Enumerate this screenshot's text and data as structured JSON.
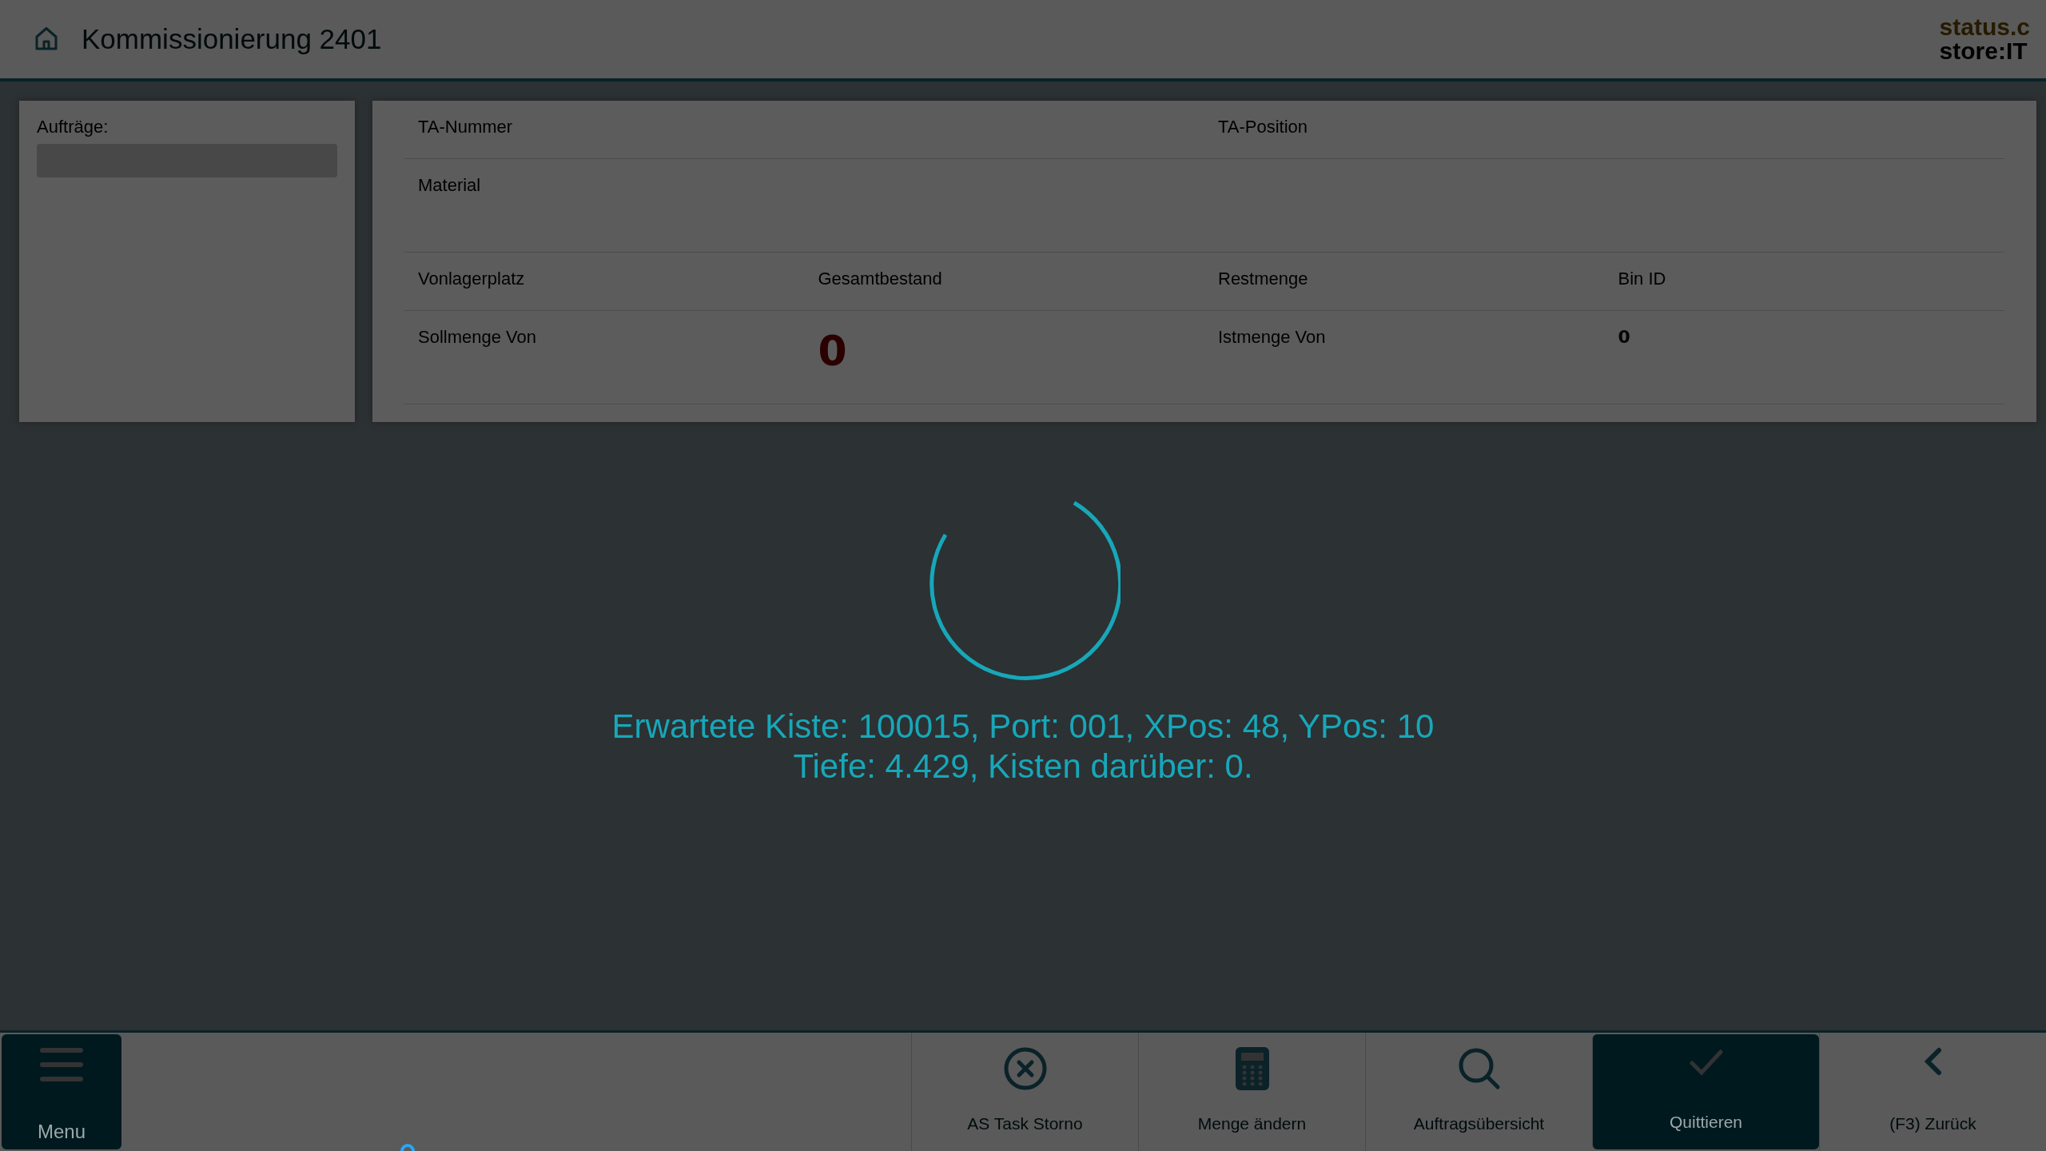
{
  "header": {
    "title": "Kommissionierung 2401",
    "logo": [
      "status.c",
      "store:IT"
    ]
  },
  "orders": {
    "label": "Aufträge:"
  },
  "fields": [
    {
      "cells": [
        {
          "kind": "label",
          "text": "TA-Nummer"
        },
        {
          "kind": "blank"
        },
        {
          "kind": "label",
          "text": "TA-Position"
        },
        {
          "kind": "blank"
        }
      ]
    },
    {
      "cells": [
        {
          "kind": "label",
          "text": "Material"
        },
        {
          "kind": "blank"
        },
        {
          "kind": "blank"
        },
        {
          "kind": "blank"
        }
      ],
      "tall": true
    },
    {
      "cells": [
        {
          "kind": "label",
          "text": "Vonlagerplatz"
        },
        {
          "kind": "label",
          "text": "Gesamtbestand"
        },
        {
          "kind": "label",
          "text": "Restmenge"
        },
        {
          "kind": "label",
          "text": "Bin ID"
        }
      ]
    },
    {
      "cells": [
        {
          "kind": "label",
          "text": "Sollmenge Von"
        },
        {
          "kind": "alert_value",
          "text": "0"
        },
        {
          "kind": "label",
          "text": "Istmenge Von"
        },
        {
          "kind": "value",
          "text": "0"
        }
      ],
      "tall": true
    }
  ],
  "loading": {
    "lines": [
      "Erwartete Kiste: 100015, Port: 001, XPos: 48, YPos: 10",
      "Tiefe: 4.429, Kisten darüber: 0."
    ]
  },
  "menu_button": {
    "label": "Menu"
  },
  "toolbar": [
    {
      "kind": "cancel",
      "label": "AS Task Storno",
      "selected": false
    },
    {
      "kind": "calculator",
      "label": "Menge ändern",
      "selected": false
    },
    {
      "kind": "search",
      "label": "Auftragsübersicht",
      "selected": false
    },
    {
      "kind": "check",
      "label": "Quittieren",
      "selected": true
    },
    {
      "kind": "back",
      "label": "(F3) Zurück",
      "selected": false
    }
  ]
}
